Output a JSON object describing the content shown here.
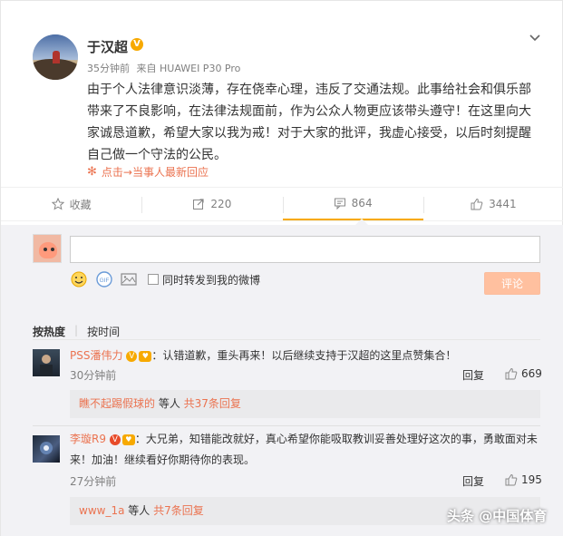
{
  "post": {
    "author": "于汉超",
    "verified_badge": "V",
    "time": "35分钟前",
    "source": "来自 HUAWEI P30 Pro",
    "text": "由于个人法律意识淡薄，存在侥幸心理，违反了交通法规。此事给社会和俱乐部带来了不良影响，在法律法规面前，作为公众人物更应该带头遵守！在这里向大家诚恳道歉，希望大家以我为戒！对于大家的批评，我虚心接受，以后时刻提醒自己做一个守法的公民。",
    "hot_link": "点击→当事人最新回应"
  },
  "actions": {
    "favorite": "收藏",
    "forward": "220",
    "comment": "864",
    "like": "3441"
  },
  "composer": {
    "forward_checkbox_label": "同时转发到我的微博",
    "submit": "评论"
  },
  "sort": {
    "hot": "按热度",
    "time": "按时间"
  },
  "comments": [
    {
      "user": "PSS潘伟力",
      "text": "：认错道歉，重头再来！以后继续支持于汉超的这里点赞集合！",
      "time": "30分钟前",
      "reply": "回复",
      "likes": "669",
      "sub_user": "瞧不起踢假球的",
      "sub_mid": " 等人 ",
      "sub_count": "共37条回复"
    },
    {
      "user": "李璇R9",
      "text": "：大兄弟，知错能改就好，真心希望你能吸取教训妥善处理好这次的事，勇敢面对未来！加油！继续看好你期待你的表现。",
      "time": "27分钟前",
      "reply": "回复",
      "likes": "195",
      "sub_user": "www_1a",
      "sub_mid": " 等人 ",
      "sub_count": "共7条回复"
    }
  ],
  "watermark": "头条 @中国体育",
  "colors": {
    "accent": "#eb7350",
    "verified": "#f7a900",
    "button": "#ffc09f"
  }
}
